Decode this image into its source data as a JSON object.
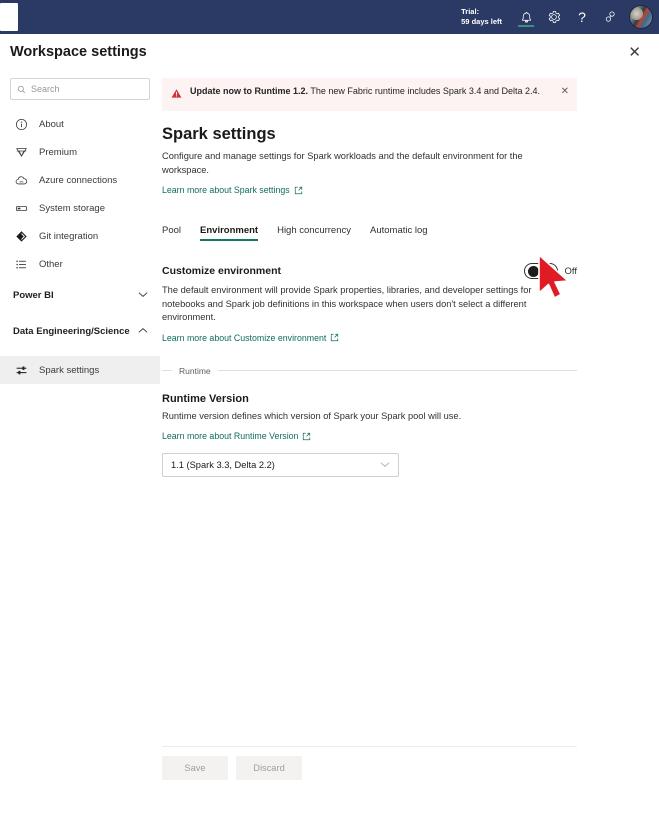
{
  "topnav": {
    "trial_line1": "Trial:",
    "trial_line2": "59 days left",
    "help_glyph": "?",
    "icons": [
      "notification-bell-icon",
      "settings-gear-icon",
      "help-icon",
      "feedback-icon",
      "user-avatar"
    ]
  },
  "header": {
    "title": "Workspace settings",
    "close_glyph": "✕"
  },
  "sidebar": {
    "search": {
      "placeholder": "Search",
      "value": ""
    },
    "items": [
      {
        "label": "About",
        "icon": "info-circle-icon"
      },
      {
        "label": "Premium",
        "icon": "diamond-icon"
      },
      {
        "label": "Azure connections",
        "icon": "cloud-icon"
      },
      {
        "label": "System storage",
        "icon": "storage-icon"
      },
      {
        "label": "Git integration",
        "icon": "git-icon"
      },
      {
        "label": "Other",
        "icon": "list-icon"
      }
    ],
    "groups": [
      {
        "label": "Power BI",
        "expanded": false,
        "chevron": "⌄"
      },
      {
        "label": "Data Engineering/Science",
        "expanded": true,
        "chevron": "⌃"
      }
    ],
    "selected_item": {
      "label": "Spark settings",
      "icon": "sliders-icon"
    }
  },
  "banner": {
    "icon": "warning-triangle-icon",
    "bold_text": "Update now to Runtime 1.2.",
    "rest_text": " The new Fabric runtime includes Spark 3.4 and Delta 2.4.",
    "close_glyph": "✕",
    "bg_color": "#fdf3f2",
    "icon_color": "#d13438"
  },
  "main": {
    "title": "Spark settings",
    "description": "Configure and manage settings for Spark workloads and the default environment for the workspace.",
    "learn_link": "Learn more about Spark settings",
    "tabs": [
      {
        "label": "Pool",
        "active": false
      },
      {
        "label": "Environment",
        "active": true
      },
      {
        "label": "High concurrency",
        "active": false
      },
      {
        "label": "Automatic log",
        "active": false
      }
    ],
    "customize": {
      "heading": "Customize environment",
      "toggle_state": "Off",
      "toggle_on": false,
      "description": "The default environment will provide Spark properties, libraries, and developer settings for notebooks and Spark job definitions in this workspace when users don't select a different environment.",
      "learn_link": "Learn more about Customize environment"
    },
    "runtime_section_label": "Runtime",
    "runtime": {
      "heading": "Runtime Version",
      "description": "Runtime version defines which version of Spark your Spark pool will use.",
      "learn_link": "Learn more about Runtime Version",
      "selected_option": "1.1 (Spark 3.3, Delta 2.2)",
      "chevron": "⌄"
    },
    "footer": {
      "save_label": "Save",
      "discard_label": "Discard"
    }
  },
  "colors": {
    "navbar": "#2b3a65",
    "accent_teal": "#117865",
    "link": "#116d5e",
    "cursor_red": "#e01b24"
  }
}
